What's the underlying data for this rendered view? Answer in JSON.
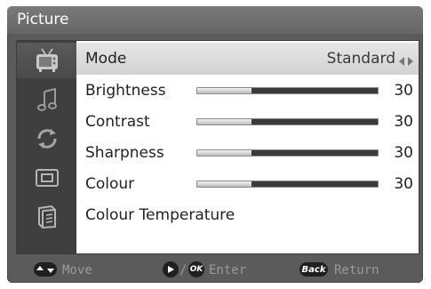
{
  "menu": {
    "title": "Picture",
    "items": [
      {
        "label": "Mode",
        "value": "Standard"
      },
      {
        "label": "Brightness",
        "value": "30",
        "level": 0.3
      },
      {
        "label": "Contrast",
        "value": "30",
        "level": 0.3
      },
      {
        "label": "Sharpness",
        "value": "30",
        "level": 0.3
      },
      {
        "label": "Colour",
        "value": "30",
        "level": 0.3
      },
      {
        "label": "Colour Temperature"
      }
    ]
  },
  "sidebar": {
    "icons": [
      "tv-icon",
      "music-note-icon",
      "refresh-icon",
      "screen-icon",
      "book-icon"
    ]
  },
  "footer": {
    "move_label": "Move",
    "enter_label": "Enter",
    "return_label": "Return",
    "ok_badge": "OK",
    "back_badge": "Back"
  },
  "colors": {
    "panel": "#5b5b5b",
    "sidebar": "#3f3f3f",
    "highlight": "#dcdcdc",
    "footer_text": "#9a9a9a"
  }
}
